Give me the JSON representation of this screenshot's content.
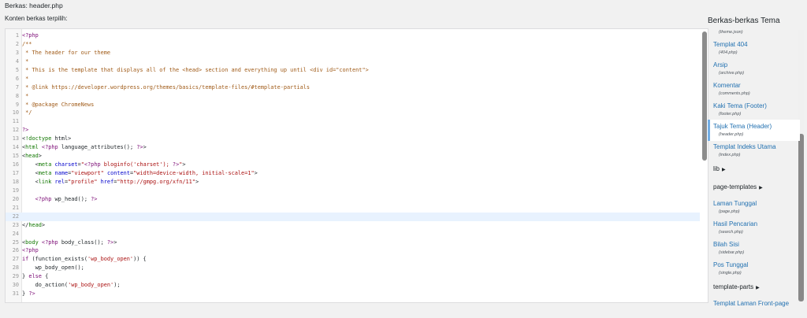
{
  "header": {
    "file_title": "Berkas: header.php",
    "content_label": "Konten berkas terpilih:"
  },
  "editor": {
    "lines": [
      {
        "n": "1",
        "t": "<?php"
      },
      {
        "n": "2",
        "t": "/**"
      },
      {
        "n": "3",
        "t": " * The header for our theme"
      },
      {
        "n": "4",
        "t": " *"
      },
      {
        "n": "5",
        "t": " * This is the template that displays all of the <head> section and everything up until <div id=\"content\">"
      },
      {
        "n": "6",
        "t": " *"
      },
      {
        "n": "7",
        "t": " * @link https://developer.wordpress.org/themes/basics/template-files/#template-partials"
      },
      {
        "n": "8",
        "t": " *"
      },
      {
        "n": "9",
        "t": " * @package ChromeNews"
      },
      {
        "n": "10",
        "t": " */"
      },
      {
        "n": "11",
        "t": ""
      },
      {
        "n": "12",
        "t": "?>"
      },
      {
        "n": "13",
        "t": "<!doctype html>"
      },
      {
        "n": "14",
        "t": "<html <?php language_attributes(); ?>>"
      },
      {
        "n": "15",
        "t": "<head>"
      },
      {
        "n": "16",
        "t": "    <meta charset=\"<?php bloginfo('charset'); ?>\">"
      },
      {
        "n": "17",
        "t": "    <meta name=\"viewport\" content=\"width=device-width, initial-scale=1\">"
      },
      {
        "n": "18",
        "t": "    <link rel=\"profile\" href=\"http://gmpg.org/xfn/11\">"
      },
      {
        "n": "19",
        "t": ""
      },
      {
        "n": "20",
        "t": "    <?php wp_head(); ?>"
      },
      {
        "n": "21",
        "t": ""
      },
      {
        "n": "22",
        "t": ""
      },
      {
        "n": "23",
        "t": "</head>"
      },
      {
        "n": "24",
        "t": ""
      },
      {
        "n": "25",
        "t": "<body <?php body_class(); ?>>"
      },
      {
        "n": "26",
        "t": "<?php"
      },
      {
        "n": "27",
        "t": "if (function_exists('wp_body_open')) {"
      },
      {
        "n": "28",
        "t": "    wp_body_open();"
      },
      {
        "n": "29",
        "t": "} else {"
      },
      {
        "n": "30",
        "t": "    do_action('wp_body_open');"
      },
      {
        "n": "31",
        "t": "} ?>"
      }
    ],
    "active_line": "22"
  },
  "sidebar": {
    "title": "Berkas-berkas Tema",
    "items": [
      {
        "type": "file-only",
        "file": "(theme.json)"
      },
      {
        "type": "item",
        "label": "Templat 404",
        "file": "(404.php)"
      },
      {
        "type": "item",
        "label": "Arsip",
        "file": "(archive.php)"
      },
      {
        "type": "item",
        "label": "Komentar",
        "file": "(comments.php)"
      },
      {
        "type": "item",
        "label": "Kaki Tema (Footer)",
        "file": "(footer.php)"
      },
      {
        "type": "item",
        "label": "Tajuk Tema (Header)",
        "file": "(header.php)",
        "current": true
      },
      {
        "type": "item",
        "label": "Templat Indeks Utama",
        "file": "(index.php)"
      },
      {
        "type": "folder",
        "label": "lib",
        "caret": "▶"
      },
      {
        "type": "folder",
        "label": "page-templates",
        "caret": "▶"
      },
      {
        "type": "item",
        "label": "Laman Tunggal",
        "file": "(page.php)"
      },
      {
        "type": "item",
        "label": "Hasil Pencarian",
        "file": "(search.php)"
      },
      {
        "type": "item",
        "label": "Bilah Sisi",
        "file": "(sidebar.php)"
      },
      {
        "type": "item",
        "label": "Pos Tunggal",
        "file": "(single.php)"
      },
      {
        "type": "folder",
        "label": "template-parts",
        "caret": "▶"
      },
      {
        "type": "item",
        "label": "Templat Laman Front-page",
        "file": ""
      }
    ]
  }
}
